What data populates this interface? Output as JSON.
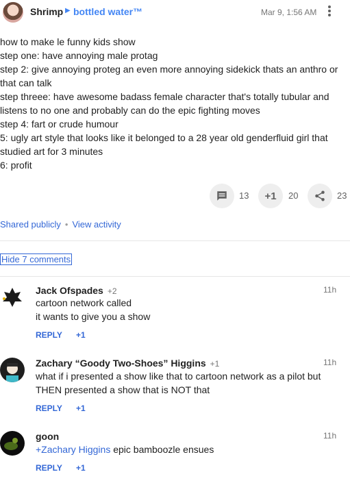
{
  "post": {
    "author": "Shrimp",
    "community": "bottled water™",
    "timestamp": "Mar 9, 1:56 AM",
    "lines": [
      "how to make le funny kids show",
      "step one: have annoying male protag",
      "step 2: give annoying proteg an even more annoying sidekick thats an anthro or that can talk",
      "step threee: have awesome badass female character that's totally tubular and listens to no one and probably can do the epic fighting moves",
      "step 4: fart or crude humour",
      "5: ugly art style that looks like it belonged to a 28 year old genderfluid girl that studied art for 3 minutes",
      "6: profit"
    ]
  },
  "actions": {
    "comment_count": "13",
    "plusone_label": "+1",
    "plusone_count": "20",
    "share_count": "23"
  },
  "meta": {
    "shared_publicly": "Shared publicly",
    "separator": "•",
    "view_activity": "View activity",
    "hide_comments": "Hide 7 comments"
  },
  "comments": [
    {
      "author": "Jack Ofspades",
      "plus": "+2",
      "time": "11h",
      "lines": [
        "cartoon network called",
        "it wants to give you a show"
      ],
      "reply": "REPLY",
      "plusone": "+1"
    },
    {
      "author": "Zachary “Goody Two-Shoes” Higgins",
      "plus": "+1",
      "time": "11h",
      "lines": [
        "what if i presented a show like that to cartoon network as a pilot but THEN presented a show that is NOT that"
      ],
      "reply": "REPLY",
      "plusone": "+1"
    },
    {
      "author": "goon",
      "plus": "",
      "time": "11h",
      "mention": "+Zachary Higgins",
      "text": " epic bamboozle ensues",
      "reply": "REPLY",
      "plusone": "+1"
    }
  ],
  "icons": {
    "comment": "comment-icon",
    "share": "share-icon",
    "more": "more-vert-icon"
  }
}
